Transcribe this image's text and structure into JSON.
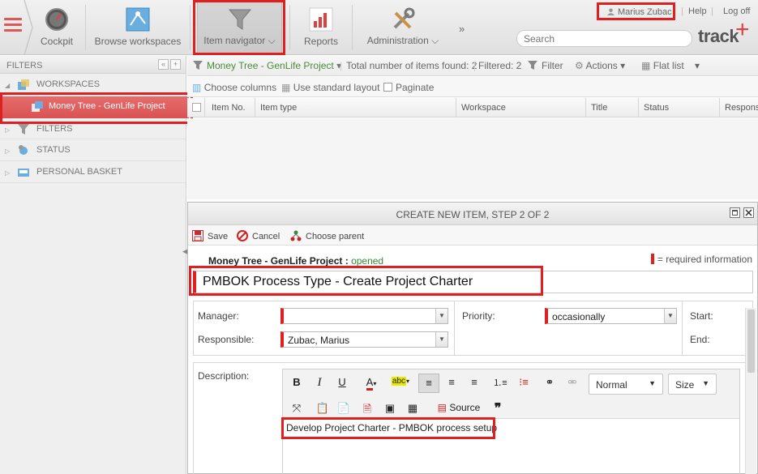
{
  "topbar": {
    "nav": [
      {
        "label": "Cockpit",
        "icon": "speedometer-icon"
      },
      {
        "label": "Browse workspaces",
        "icon": "workspace-diagram-icon"
      },
      {
        "label": "Item navigator",
        "icon": "funnel-icon"
      },
      {
        "label": "Reports",
        "icon": "bar-chart-icon"
      },
      {
        "label": "Administration",
        "icon": "tools-icon"
      }
    ],
    "more": "»",
    "user": "Marius Zubac",
    "help": "Help",
    "logoff": "Log off",
    "search_placeholder": "Search",
    "logo": "track",
    "logo_plus": "+"
  },
  "left": {
    "header": "FILTERS",
    "collapse": "«",
    "add": "+",
    "tree": [
      {
        "label": "WORKSPACES",
        "icon": "workspaces-icon",
        "expanded": true
      },
      {
        "label": "Money Tree - GenLife Project",
        "icon": "project-icon",
        "selected": true
      },
      {
        "label": "FILTERS",
        "icon": "funnel-icon"
      },
      {
        "label": "STATUS",
        "icon": "status-icon"
      },
      {
        "label": "PERSONAL BASKET",
        "icon": "basket-icon"
      }
    ]
  },
  "grid": {
    "context": "Money Tree - GenLife Project",
    "total": "Total number of items found: 2",
    "filtered": "Filtered: 2",
    "filter": "Filter",
    "actions": "Actions",
    "view": "Flat list",
    "choose_columns": "Choose columns",
    "standard_layout": "Use standard layout",
    "paginate": "Paginate",
    "columns": [
      "Item No.",
      "Item type",
      "Workspace",
      "Title",
      "Status",
      "Respons"
    ]
  },
  "dialog": {
    "title": "CREATE NEW ITEM, STEP 2 OF 2",
    "save": "Save",
    "cancel": "Cancel",
    "choose_parent": "Choose parent",
    "project": "Money Tree - GenLife Project",
    "project_sep": ":",
    "project_status": "opened",
    "required_info": "= required information",
    "item_title": "PMBOK Process Type - Create Project Charter",
    "manager_label": "Manager:",
    "manager_value": "",
    "responsible_label": "Responsible:",
    "responsible_value": "Zubac, Marius",
    "priority_label": "Priority:",
    "priority_value": "occasionally",
    "start_label": "Start:",
    "end_label": "End:",
    "description_label": "Description:",
    "editor": {
      "bold": "B",
      "italic": "I",
      "underline": "U",
      "font_color": "A",
      "highlight": "abc",
      "format": "Normal",
      "size": "Size",
      "source": "Source",
      "quote": "❞"
    },
    "description_text": "Develop Project Charter - PMBOK process setup"
  },
  "colors": {
    "accent_red": "#e02020",
    "selection": "#e06060",
    "status_green": "#3a8a3a"
  }
}
